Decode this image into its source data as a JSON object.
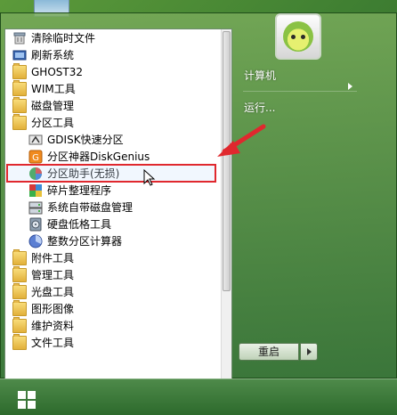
{
  "menu": {
    "items": [
      {
        "label": "清除临时文件",
        "icon": "cleanup-icon",
        "type": "app"
      },
      {
        "label": "刷新系统",
        "icon": "refresh-icon",
        "type": "app"
      },
      {
        "label": "GHOST32",
        "icon": "folder-icon",
        "type": "folder"
      },
      {
        "label": "WIM工具",
        "icon": "folder-icon",
        "type": "folder"
      },
      {
        "label": "磁盘管理",
        "icon": "folder-icon",
        "type": "folder"
      },
      {
        "label": "分区工具",
        "icon": "folder-icon",
        "type": "folder"
      },
      {
        "label": "GDISK快速分区",
        "icon": "gdisk-icon",
        "type": "sub"
      },
      {
        "label": "分区神器DiskGenius",
        "icon": "diskgenius-icon",
        "type": "sub"
      },
      {
        "label": "分区助手(无损)",
        "icon": "partition-assistant-icon",
        "type": "sub",
        "highlighted": true
      },
      {
        "label": "碎片整理程序",
        "icon": "defrag-icon",
        "type": "sub"
      },
      {
        "label": "系统自带磁盘管理",
        "icon": "disk-management-icon",
        "type": "sub"
      },
      {
        "label": "硬盘低格工具",
        "icon": "lowformat-icon",
        "type": "sub"
      },
      {
        "label": "整数分区计算器",
        "icon": "calculator-icon",
        "type": "sub"
      },
      {
        "label": "附件工具",
        "icon": "folder-icon",
        "type": "folder"
      },
      {
        "label": "管理工具",
        "icon": "folder-icon",
        "type": "folder"
      },
      {
        "label": "光盘工具",
        "icon": "folder-icon",
        "type": "folder"
      },
      {
        "label": "图形图像",
        "icon": "folder-icon",
        "type": "folder"
      },
      {
        "label": "维护资料",
        "icon": "folder-icon",
        "type": "folder"
      },
      {
        "label": "文件工具",
        "icon": "folder-icon",
        "type": "folder"
      }
    ]
  },
  "right": {
    "computer": "计算机",
    "run": "运行..."
  },
  "power": {
    "restart": "重启"
  },
  "colors": {
    "highlight_border": "#e0282e",
    "annotation_arrow": "#e0282e"
  }
}
